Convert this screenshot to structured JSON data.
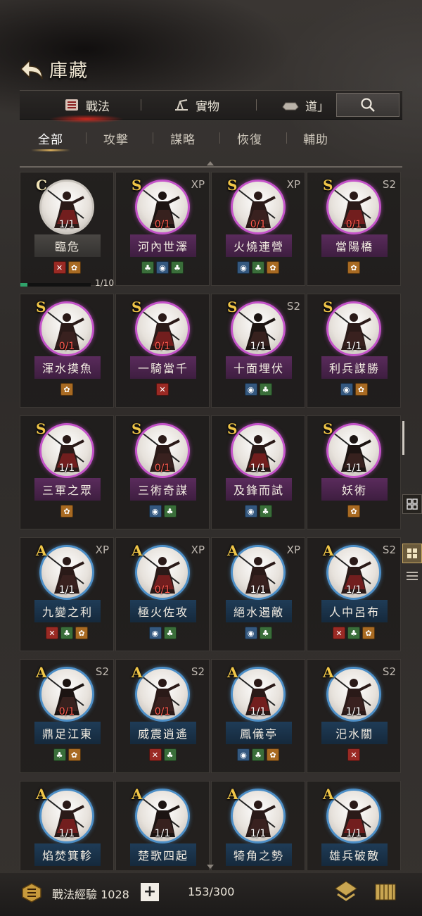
{
  "header": {
    "title": "庫藏"
  },
  "top_tabs": [
    {
      "label": "戰法",
      "icon": "scroll-icon",
      "active": true
    },
    {
      "label": "實物",
      "icon": "plow-icon",
      "active": false
    },
    {
      "label": "道」",
      "icon": "ingot-icon",
      "active": false
    }
  ],
  "filters": [
    "全部",
    "攻擊",
    "謀略",
    "恢復",
    "輔助"
  ],
  "cards": [
    {
      "grade": "C",
      "tag": "",
      "count": "1/1",
      "name": "臨危",
      "icons": [
        "red",
        "orange"
      ],
      "progress": {
        "label": "1/10",
        "fraction": 0.1
      }
    },
    {
      "grade": "S",
      "tag": "XP",
      "count": "0/1",
      "name": "河內世澤",
      "icons": [
        "green",
        "blue",
        "green"
      ]
    },
    {
      "grade": "S",
      "tag": "XP",
      "count": "0/1",
      "name": "火燒連營",
      "icons": [
        "blue",
        "green",
        "orange"
      ]
    },
    {
      "grade": "S",
      "tag": "S2",
      "count": "0/1",
      "name": "當陽橋",
      "icons": [
        "orange"
      ]
    },
    {
      "grade": "S",
      "tag": "",
      "count": "0/1",
      "name": "渾水摸魚",
      "icons": [
        "orange"
      ]
    },
    {
      "grade": "S",
      "tag": "",
      "count": "0/1",
      "name": "一騎當千",
      "icons": [
        "red"
      ]
    },
    {
      "grade": "S",
      "tag": "S2",
      "count": "1/1",
      "name": "十面埋伏",
      "icons": [
        "blue",
        "green"
      ]
    },
    {
      "grade": "S",
      "tag": "",
      "count": "1/1",
      "name": "利兵謀勝",
      "icons": [
        "blue",
        "orange"
      ]
    },
    {
      "grade": "S",
      "tag": "",
      "count": "1/1",
      "name": "三軍之眾",
      "icons": [
        "orange"
      ]
    },
    {
      "grade": "S",
      "tag": "",
      "count": "0/1",
      "name": "三術奇謀",
      "icons": [
        "blue",
        "green"
      ]
    },
    {
      "grade": "S",
      "tag": "",
      "count": "1/1",
      "name": "及鋒而試",
      "icons": [
        "blue",
        "green"
      ]
    },
    {
      "grade": "S",
      "tag": "",
      "count": "1/1",
      "name": "妖術",
      "icons": [
        "orange"
      ]
    },
    {
      "grade": "A",
      "tag": "XP",
      "count": "1/1",
      "name": "九變之利",
      "icons": [
        "red",
        "green",
        "orange"
      ]
    },
    {
      "grade": "A",
      "tag": "XP",
      "count": "0/1",
      "name": "極火佐攻",
      "icons": [
        "blue",
        "green"
      ]
    },
    {
      "grade": "A",
      "tag": "XP",
      "count": "1/1",
      "name": "絕水遏敵",
      "icons": [
        "blue",
        "green"
      ]
    },
    {
      "grade": "A",
      "tag": "S2",
      "count": "1/1",
      "name": "人中呂布",
      "icons": [
        "red",
        "green",
        "orange"
      ]
    },
    {
      "grade": "A",
      "tag": "S2",
      "count": "0/1",
      "name": "鼎足江東",
      "icons": [
        "green",
        "orange"
      ]
    },
    {
      "grade": "A",
      "tag": "S2",
      "count": "0/1",
      "name": "威震逍遙",
      "icons": [
        "red",
        "green"
      ]
    },
    {
      "grade": "A",
      "tag": "",
      "count": "1/1",
      "name": "鳳儀亭",
      "icons": [
        "blue",
        "green",
        "orange"
      ]
    },
    {
      "grade": "A",
      "tag": "S2",
      "count": "1/1",
      "name": "汜水關",
      "icons": [
        "red"
      ]
    },
    {
      "grade": "A",
      "tag": "",
      "count": "1/1",
      "name": "焰焚箕軫",
      "icons": []
    },
    {
      "grade": "A",
      "tag": "",
      "count": "1/1",
      "name": "楚歌四起",
      "icons": []
    },
    {
      "grade": "A",
      "tag": "",
      "count": "1/1",
      "name": "犄角之勢",
      "icons": []
    },
    {
      "grade": "A",
      "tag": "",
      "count": "1/1",
      "name": "雄兵破敵",
      "icons": []
    }
  ],
  "footer": {
    "exp_label": "戰法經驗 1028",
    "plus_label": "+",
    "capacity": "153/300"
  }
}
